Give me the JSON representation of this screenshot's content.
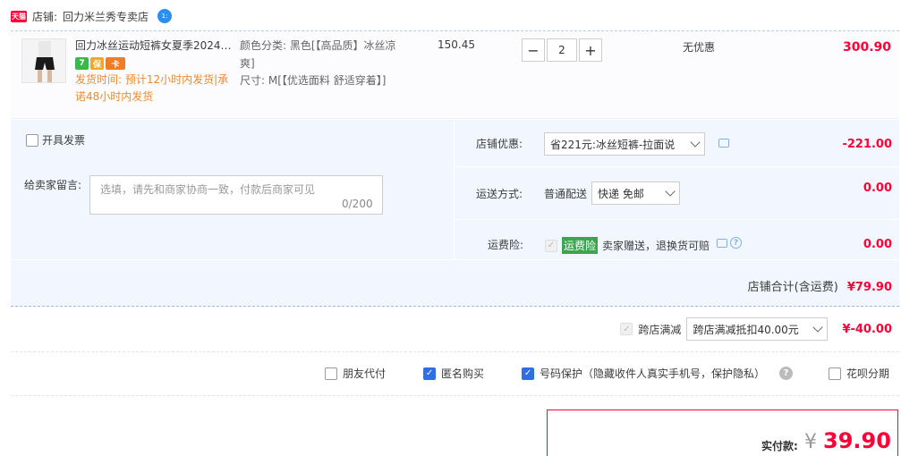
{
  "shop": {
    "tag": "天猫",
    "label": "店铺:",
    "name": "回力米兰秀专卖店",
    "chat_badge": "1:"
  },
  "item": {
    "title": "回力冰丝运动短裤女夏季2024…",
    "badge_texts": [
      "7",
      "保",
      "卡"
    ],
    "ship_note": "发货时间: 预计12小时内发货|承诺48小时内发货",
    "attr_color": "颜色分类: 黑色[【高品质】冰丝凉爽]",
    "attr_size": "尺寸: M[【优选面料 舒适穿着】]",
    "unit_price": "150.45",
    "qty": "2",
    "qty_minus": "−",
    "qty_plus": "+",
    "discount": "无优惠",
    "total": "300.90"
  },
  "options": {
    "invoice_label": "开具发票",
    "msg_label": "给卖家留言:",
    "msg_placeholder": "选填，请先和商家协商一致，付款后商家可见",
    "msg_count": "0/200",
    "coupon_label": "店铺优惠:",
    "coupon_value": "省221元:冰丝短裤-拉面说",
    "coupon_amount": "-221.00",
    "ship_label": "运送方式:",
    "ship_method": "普通配送",
    "ship_value": "快递 免邮",
    "ship_amount": "0.00",
    "ins_label": "运费险:",
    "ins_tag": "运费险",
    "ins_desc": "卖家赠送，退换货可赔",
    "ins_amount": "0.00",
    "shop_total_label": "店铺合计(含运费)",
    "shop_total": "¥79.90"
  },
  "cross": {
    "label": "跨店满减",
    "select": "跨店满减抵扣40.00元",
    "amount": "¥-40.00"
  },
  "extras": {
    "friend_pay": "朋友代付",
    "anon_buy": "匿名购买",
    "phone_protect": "号码保护（隐藏收件人真实手机号，保护隐私）",
    "huabei": "花呗分期"
  },
  "pay": {
    "label": "实付款:",
    "yen": "¥",
    "amount": "39.90"
  },
  "colors": {
    "accent_red": "#ff0036",
    "link_blue": "#2d6fe8",
    "panel_bg": "#f2f7ff"
  }
}
